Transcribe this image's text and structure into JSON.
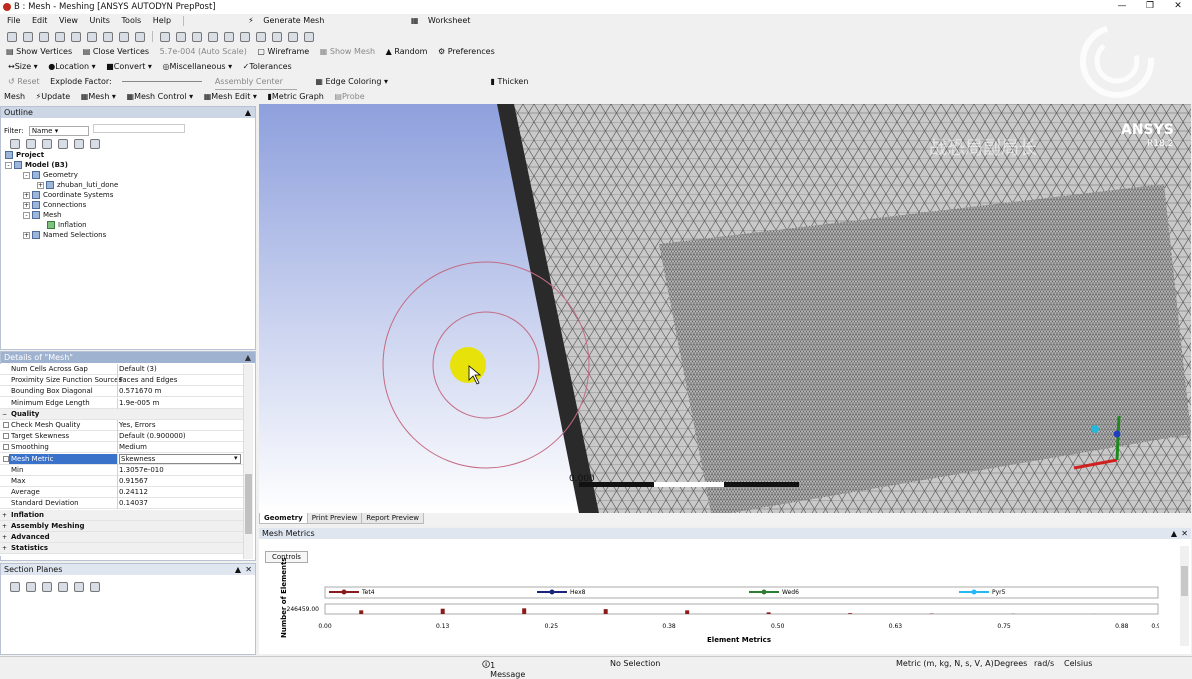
{
  "window": {
    "title": "B : Mesh - Meshing [ANSYS AUTODYN PrepPost]"
  },
  "menu": [
    "File",
    "Edit",
    "View",
    "Units",
    "Tools",
    "Help"
  ],
  "toolbar1": {
    "generate_mesh": "Generate Mesh",
    "worksheet": "Worksheet"
  },
  "toolbar2": {
    "show_vertices": "Show Vertices",
    "close_vertices": "Close Vertices",
    "tolerance": "5.7e-004 (Auto Scale)",
    "wireframe": "Wireframe",
    "show_mesh": "Show Mesh",
    "random": "Random",
    "preferences": "Preferences"
  },
  "toolbar3": {
    "size": "Size",
    "location": "Location",
    "convert": "Convert",
    "miscellaneous": "Miscellaneous",
    "tolerances": "Tolerances"
  },
  "toolbar4": {
    "reset": "Reset",
    "explode_factor": "Explode Factor:",
    "assembly_center": "Assembly Center",
    "edge_coloring": "Edge Coloring",
    "thicken": "Thicken"
  },
  "toolbar5": {
    "mesh": "Mesh",
    "update": "Update",
    "mesh_dd": "Mesh",
    "mesh_control": "Mesh Control",
    "mesh_edit": "Mesh Edit",
    "metric_graph": "Metric Graph",
    "probe": "Probe"
  },
  "outline": {
    "title": "Outline",
    "filter_label": "Filter:",
    "filter_value": "Name",
    "tree": [
      "Project",
      "Model (B3)",
      "Geometry",
      "zhuban_luti_done",
      "Coordinate Systems",
      "Connections",
      "Mesh",
      "Inflation",
      "Named Selections"
    ]
  },
  "details": {
    "title": "Details of \"Mesh\"",
    "rows": [
      {
        "k": "Num Cells Across Gap",
        "v": "Default (3)"
      },
      {
        "k": "Proximity Size Function Sources",
        "v": "Faces and Edges"
      },
      {
        "k": "Bounding Box Diagonal",
        "v": "0.571670 m"
      },
      {
        "k": "Minimum Edge Length",
        "v": "1.9e-005 m"
      },
      {
        "k": "Quality",
        "v": ""
      },
      {
        "k": "Check Mesh Quality",
        "v": "Yes, Errors"
      },
      {
        "k": "Target Skewness",
        "v": "Default (0.900000)"
      },
      {
        "k": "Smoothing",
        "v": "Medium"
      },
      {
        "k": "Mesh Metric",
        "v": "Skewness"
      },
      {
        "k": "Min",
        "v": "1.3057e-010"
      },
      {
        "k": "Max",
        "v": "0.91567"
      },
      {
        "k": "Average",
        "v": "0.24112"
      },
      {
        "k": "Standard Deviation",
        "v": "0.14037"
      },
      {
        "k": "Inflation",
        "v": ""
      },
      {
        "k": "Assembly Meshing",
        "v": ""
      },
      {
        "k": "Advanced",
        "v": ""
      },
      {
        "k": "Statistics",
        "v": ""
      }
    ]
  },
  "section_planes": {
    "title": "Section Planes"
  },
  "viewport": {
    "brand": "ANSYS",
    "version": "R18.2",
    "scale_label": "0.000",
    "watermark": "战恐局副局长"
  },
  "view_tabs": [
    "Geometry",
    "Print Preview",
    "Report Preview"
  ],
  "mesh_metrics": {
    "title": "Mesh Metrics",
    "controls": "Controls"
  },
  "chart_data": {
    "type": "bar",
    "xlabel": "Element Metrics",
    "ylabel": "Number of Elements",
    "x_ticks": [
      "0.00",
      "0.13",
      "0.25",
      "0.38",
      "0.50",
      "0.63",
      "0.75",
      "0.88",
      "0.92"
    ],
    "y_tick": "246459.00",
    "legend": [
      "Tet4",
      "Hex8",
      "Wed6",
      "Pyr5"
    ],
    "colors": {
      "Tet4": "#8b1a1a",
      "Hex8": "#1a237e",
      "Wed6": "#2e7d32",
      "Pyr5": "#29b6f6"
    },
    "series": [
      {
        "name": "Tet4",
        "x": [
          0.04,
          0.13,
          0.22,
          0.31,
          0.4,
          0.49,
          0.58,
          0.67,
          0.76,
          0.85
        ],
        "values": [
          90000,
          130000,
          140000,
          120000,
          90000,
          40000,
          20000,
          10000,
          5000,
          2000
        ]
      }
    ],
    "ylim": [
      0,
      246459
    ],
    "xlim": [
      0,
      0.92
    ]
  },
  "status": {
    "messages": "1 Message",
    "selection": "No Selection",
    "units": "Metric (m, kg, N, s, V, A)",
    "angle": "Degrees",
    "rate": "rad/s",
    "temp": "Celsius"
  }
}
